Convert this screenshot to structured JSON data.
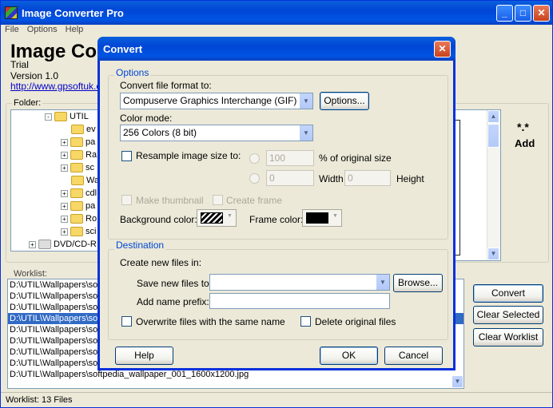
{
  "main": {
    "title": "Image Converter Pro",
    "menu": [
      "File",
      "Options",
      "Help"
    ],
    "brand": "Image Co",
    "edition": "Trial",
    "version": "Version 1.0",
    "link": "http://www.gpsoftuk.co",
    "folder_label": "Folder:",
    "tree": [
      {
        "label": "UTIL",
        "expander": "-"
      },
      {
        "label": "ev",
        "expander": ""
      },
      {
        "label": "pa",
        "expander": "+"
      },
      {
        "label": "Ra",
        "expander": "+"
      },
      {
        "label": "sc",
        "expander": "+"
      },
      {
        "label": "Wa",
        "expander": ""
      },
      {
        "label": "cdl",
        "expander": "+"
      },
      {
        "label": "pa",
        "expander": "+"
      },
      {
        "label": "Ro",
        "expander": "+"
      },
      {
        "label": "sci",
        "expander": "+"
      },
      {
        "label": "DVD/CD-R",
        "expander": "+"
      }
    ],
    "add_label": "Add",
    "worklist_label": "Worklist:",
    "worklist": [
      "D:\\UTIL\\Wallpapers\\so",
      "D:\\UTIL\\Wallpapers\\so",
      "D:\\UTIL\\Wallpapers\\so",
      "D:\\UTIL\\Wallpapers\\so",
      "D:\\UTIL\\Wallpapers\\so",
      "D:\\UTIL\\Wallpapers\\so",
      "D:\\UTIL\\Wallpapers\\so",
      "D:\\UTIL\\Wallpapers\\softpedia_wallpaper_001_1280x960.jpg",
      "D:\\UTIL\\Wallpapers\\softpedia_wallpaper_001_1600x1200.jpg"
    ],
    "selected_row": 3,
    "buttons": {
      "convert": "Convert",
      "clear_selected": "Clear Selected",
      "clear_worklist": "Clear Worklist"
    },
    "status": "Worklist: 13 Files"
  },
  "dialog": {
    "title": "Convert",
    "options_group": "Options",
    "format_label": "Convert file format to:",
    "format_value": "Compuserve Graphics Interchange (GIF)",
    "options_button": "Options...",
    "color_mode_label": "Color mode:",
    "color_mode_value": "256 Colors (8 bit)",
    "resample_label": "Resample image size to:",
    "percent_value": "100",
    "percent_label": "% of original size",
    "width_value": "0",
    "width_label": "Width",
    "height_value": "0",
    "height_label": "Height",
    "thumbnail_label": "Make thumbnail",
    "frame_label": "Create frame",
    "bg_color_label": "Background color:",
    "frame_color_label": "Frame color:",
    "frame_color": "#000000",
    "destination_group": "Destination",
    "create_label": "Create new files in:",
    "save_label": "Save new files to:",
    "save_value": "",
    "browse_button": "Browse...",
    "prefix_label": "Add name prefix:",
    "prefix_value": "",
    "overwrite_label": "Overwrite files with the same name",
    "delete_label": "Delete original files",
    "help_button": "Help",
    "ok_button": "OK",
    "cancel_button": "Cancel"
  }
}
